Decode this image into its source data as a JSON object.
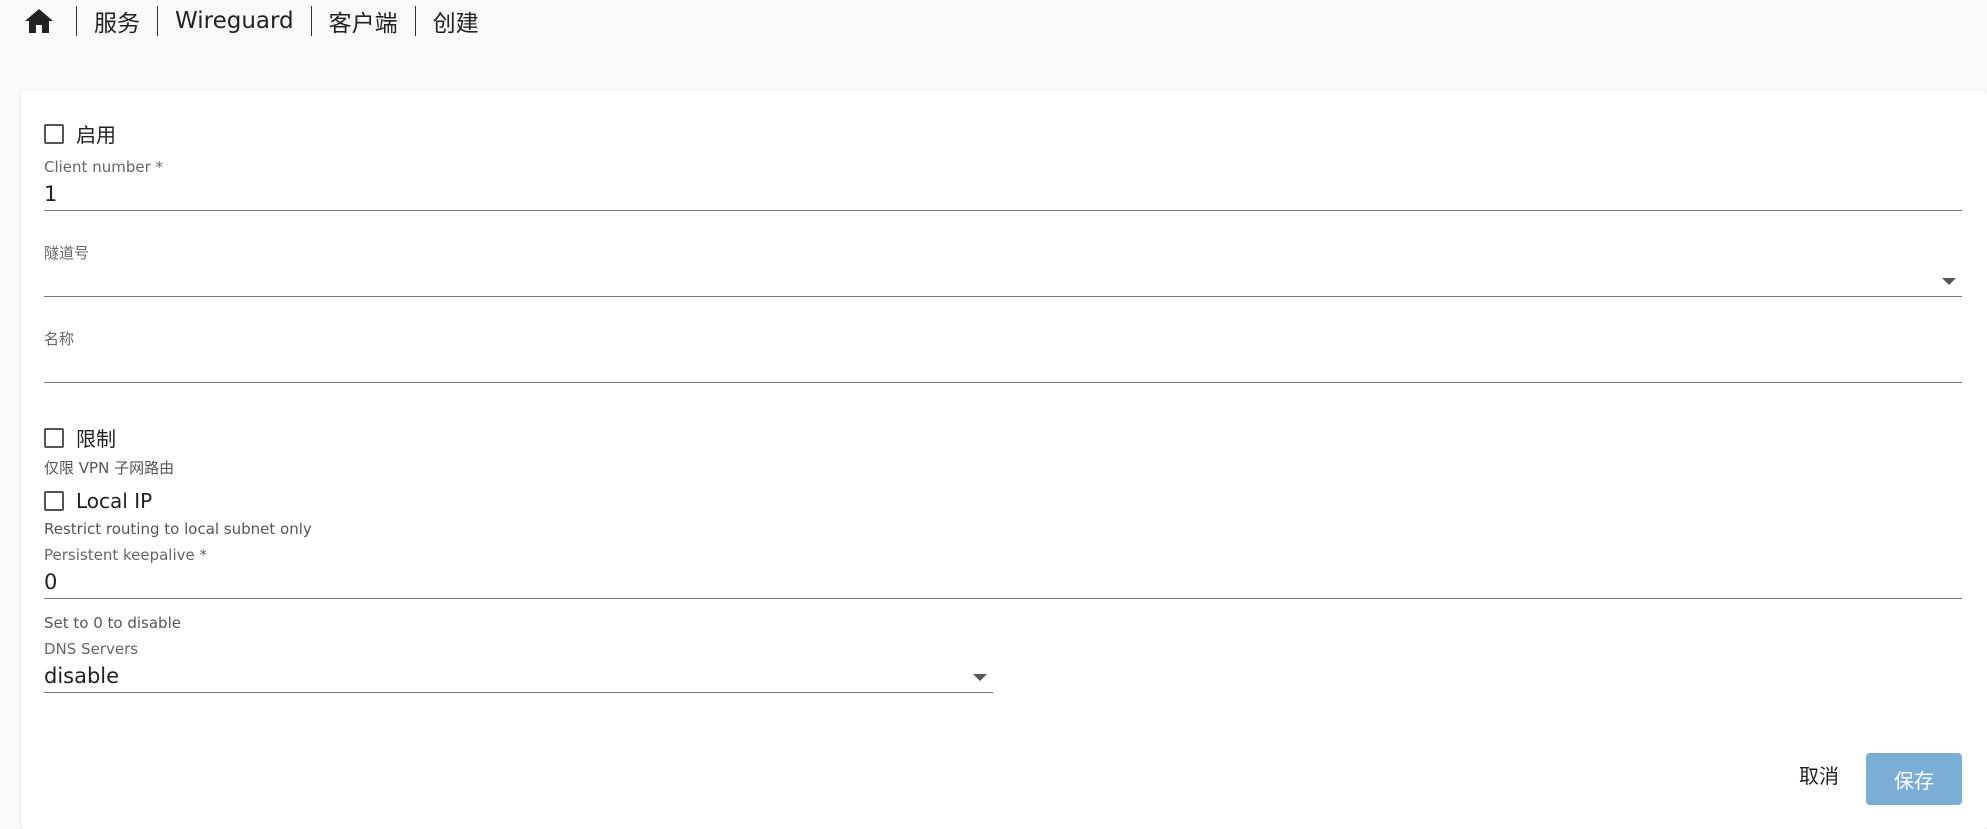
{
  "breadcrumb": {
    "home_icon": "home-icon",
    "items": [
      "服务",
      "Wireguard",
      "客户端",
      "创建"
    ]
  },
  "form": {
    "enable": {
      "label": "启用",
      "checked": false
    },
    "client_number": {
      "label": "Client number *",
      "value": "1"
    },
    "tunnel": {
      "label": "隧道号",
      "value": ""
    },
    "name": {
      "label": "名称",
      "value": ""
    },
    "restrict": {
      "label": "限制",
      "checked": false,
      "helper": "仅限 VPN 子网路由"
    },
    "local_ip": {
      "label": "Local IP",
      "checked": false,
      "helper": "Restrict routing to local subnet only"
    },
    "keepalive": {
      "label": "Persistent keepalive *",
      "value": "0",
      "helper": "Set to 0 to disable"
    },
    "dns": {
      "label": "DNS Servers",
      "value": "disable"
    }
  },
  "actions": {
    "cancel_label": "取消",
    "save_label": "保存"
  },
  "colors": {
    "save_button": "#7aaed6",
    "background": "#f9f9f9"
  }
}
